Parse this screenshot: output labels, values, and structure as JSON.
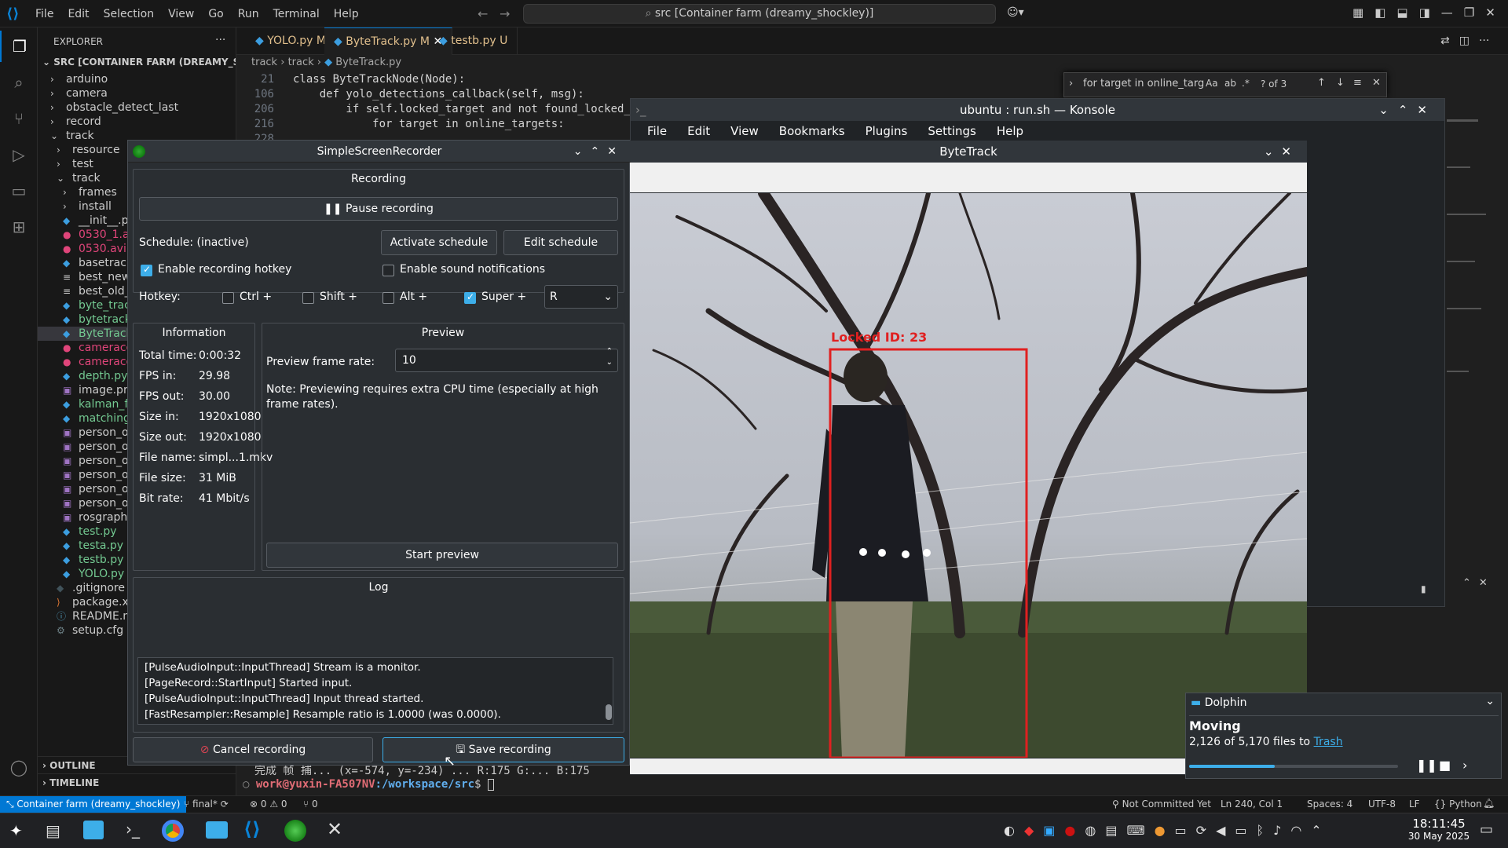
{
  "vscode": {
    "menu": [
      "File",
      "Edit",
      "Selection",
      "View",
      "Go",
      "Run",
      "Terminal",
      "Help"
    ],
    "command_center": "src [Container farm (dreamy_shockley)]",
    "explorer": {
      "header": "EXPLORER",
      "root": "SRC [CONTAINER FARM (DREAMY_SHOCK...",
      "items": [
        {
          "label": "arduino",
          "icon": "folder",
          "indent": 1
        },
        {
          "label": "camera",
          "icon": "folder",
          "indent": 1
        },
        {
          "label": "obstacle_detect_last",
          "icon": "folder",
          "indent": 1
        },
        {
          "label": "record",
          "icon": "folder",
          "indent": 1
        },
        {
          "label": "track",
          "icon": "folder-open",
          "indent": 1
        },
        {
          "label": "resource",
          "icon": "folder",
          "indent": 2
        },
        {
          "label": "test",
          "icon": "folder",
          "indent": 2
        },
        {
          "label": "track",
          "icon": "folder-open",
          "indent": 2
        },
        {
          "label": "frames",
          "icon": "folder",
          "indent": 3
        },
        {
          "label": "install",
          "icon": "folder",
          "indent": 3
        },
        {
          "label": "__init__.py",
          "icon": "python",
          "indent": 3
        },
        {
          "label": "0530_1.avi",
          "icon": "video",
          "indent": 3
        },
        {
          "label": "0530.avi",
          "icon": "video",
          "indent": 3
        },
        {
          "label": "basetrack.",
          "icon": "python",
          "indent": 3
        },
        {
          "label": "best_new_",
          "icon": "file",
          "indent": 3
        },
        {
          "label": "best_old_l",
          "icon": "file",
          "indent": 3
        },
        {
          "label": "byte_track",
          "icon": "python",
          "indent": 3
        },
        {
          "label": "bytetrack.p",
          "icon": "python",
          "indent": 3
        },
        {
          "label": "ByteTrack.",
          "icon": "python",
          "indent": 3,
          "selected": true
        },
        {
          "label": "cameracol",
          "icon": "video",
          "indent": 3
        },
        {
          "label": "cameracol",
          "icon": "video",
          "indent": 3
        },
        {
          "label": "depth.py",
          "icon": "python",
          "indent": 3
        },
        {
          "label": "image.png",
          "icon": "image",
          "indent": 3
        },
        {
          "label": "kalman_filt",
          "icon": "python",
          "indent": 3
        },
        {
          "label": "matching.p",
          "icon": "python",
          "indent": 3
        },
        {
          "label": "person_ou",
          "icon": "image",
          "indent": 3
        },
        {
          "label": "person_ou",
          "icon": "image",
          "indent": 3
        },
        {
          "label": "person_ou",
          "icon": "image",
          "indent": 3
        },
        {
          "label": "person_ou",
          "icon": "image",
          "indent": 3
        },
        {
          "label": "person_ou",
          "icon": "image",
          "indent": 3
        },
        {
          "label": "person_ou",
          "icon": "image",
          "indent": 3
        },
        {
          "label": "rosgraph.p",
          "icon": "image",
          "indent": 3
        },
        {
          "label": "test.py",
          "icon": "python",
          "indent": 3
        },
        {
          "label": "testa.py",
          "icon": "python",
          "indent": 3
        },
        {
          "label": "testb.py",
          "icon": "python",
          "indent": 3
        },
        {
          "label": "YOLO.py",
          "icon": "python",
          "indent": 3
        },
        {
          "label": ".gitignore",
          "icon": "git",
          "indent": 2
        },
        {
          "label": "package.xm",
          "icon": "xml",
          "indent": 2
        },
        {
          "label": "README.mc",
          "icon": "info",
          "indent": 2
        },
        {
          "label": "setup.cfg",
          "icon": "gear",
          "indent": 2
        }
      ],
      "outline": "OUTLINE",
      "timeline": "TIMELINE"
    },
    "tabs": [
      {
        "label": "YOLO.py",
        "badge": "M",
        "active": false
      },
      {
        "label": "ByteTrack.py",
        "badge": "M",
        "active": true
      },
      {
        "label": "testb.py",
        "badge": "U",
        "active": false
      }
    ],
    "breadcrumb": [
      "track",
      "track",
      "ByteTrack.py"
    ],
    "code": [
      {
        "ln": "21",
        "text": "class ByteTrackNode(Node):"
      },
      {
        "ln": "106",
        "text": "    def yolo_detections_callback(self, msg):"
      },
      {
        "ln": "206",
        "text": "        if self.locked_target and not found_locked_"
      },
      {
        "ln": "216",
        "text": "            for target in online_targets:"
      },
      {
        "ln": "228",
        "text": ""
      }
    ],
    "find": {
      "query": "for target in online_targ",
      "options": "Aa",
      "result": "? of 3"
    },
    "terminal": {
      "line1": "完成 帧 捕... (x=-574, y=-234) ... R:175 G:... B:175",
      "prompt_user": "work@yuxin-FA507NV",
      "prompt_path": ":/workspace/src",
      "prompt_sym": "$"
    },
    "status": {
      "remote": "Container farm (dreamy_shockley)",
      "branch": "final*",
      "errors": "0",
      "warnings": "0",
      "ports": "0",
      "commit": "Not Committed Yet",
      "position": "Ln 240, Col 1",
      "spaces": "Spaces: 4",
      "encoding": "UTF-8",
      "eol": "LF",
      "language": "Python"
    }
  },
  "konsole": {
    "title": "ubuntu : run.sh — Konsole",
    "menu": [
      "File",
      "Edit",
      "View",
      "Bookmarks",
      "Plugins",
      "Settings",
      "Help"
    ]
  },
  "bytetrack": {
    "title": "ByteTrack",
    "box_label": "Locked ID: 23",
    "box_color": "#e02020"
  },
  "ssr": {
    "title": "SimpleScreenRecorder",
    "recording_header": "Recording",
    "pause_label": "Pause recording",
    "schedule_label": "Schedule: (inactive)",
    "activate_schedule": "Activate schedule",
    "edit_schedule": "Edit schedule",
    "enable_hotkey": "Enable recording hotkey",
    "enable_hotkey_checked": true,
    "enable_sound": "Enable sound notifications",
    "enable_sound_checked": false,
    "hotkey_label": "Hotkey:",
    "mods": [
      {
        "label": "Ctrl +",
        "checked": false
      },
      {
        "label": "Shift +",
        "checked": false
      },
      {
        "label": "Alt +",
        "checked": false
      },
      {
        "label": "Super +",
        "checked": true
      }
    ],
    "key": "R",
    "info_header": "Information",
    "info": [
      {
        "k": "Total time:",
        "v": "0:00:32"
      },
      {
        "k": "FPS in:",
        "v": "29.98"
      },
      {
        "k": "FPS out:",
        "v": "30.00"
      },
      {
        "k": "Size in:",
        "v": "1920x1080"
      },
      {
        "k": "Size out:",
        "v": "1920x1080"
      },
      {
        "k": "File name:",
        "v": "simpl...1.mkv"
      },
      {
        "k": "File size:",
        "v": "31 MiB"
      },
      {
        "k": "Bit rate:",
        "v": "41 Mbit/s"
      }
    ],
    "preview_header": "Preview",
    "preview_rate_label": "Preview frame rate:",
    "preview_rate": "10",
    "preview_note": "Note: Previewing requires extra CPU time (especially at high frame rates).",
    "start_preview": "Start preview",
    "log_header": "Log",
    "log": [
      "[PulseAudioInput::InputThread] Stream is a monitor.",
      "[PageRecord::StartInput] Started input.",
      "[PulseAudioInput::InputThread] Input thread started.",
      "[FastResampler::Resample] Resample ratio is 1.0000 (was 0.0000)."
    ],
    "cancel": "Cancel recording",
    "save": "Save recording"
  },
  "dolphin": {
    "app": "Dolphin",
    "title": "Moving",
    "progress_text": "2,126 of 5,170 files to",
    "link": "Trash",
    "progress_fraction": 0.41
  },
  "taskbar": {
    "time": "18:11:45",
    "date": "30 May 2025"
  }
}
